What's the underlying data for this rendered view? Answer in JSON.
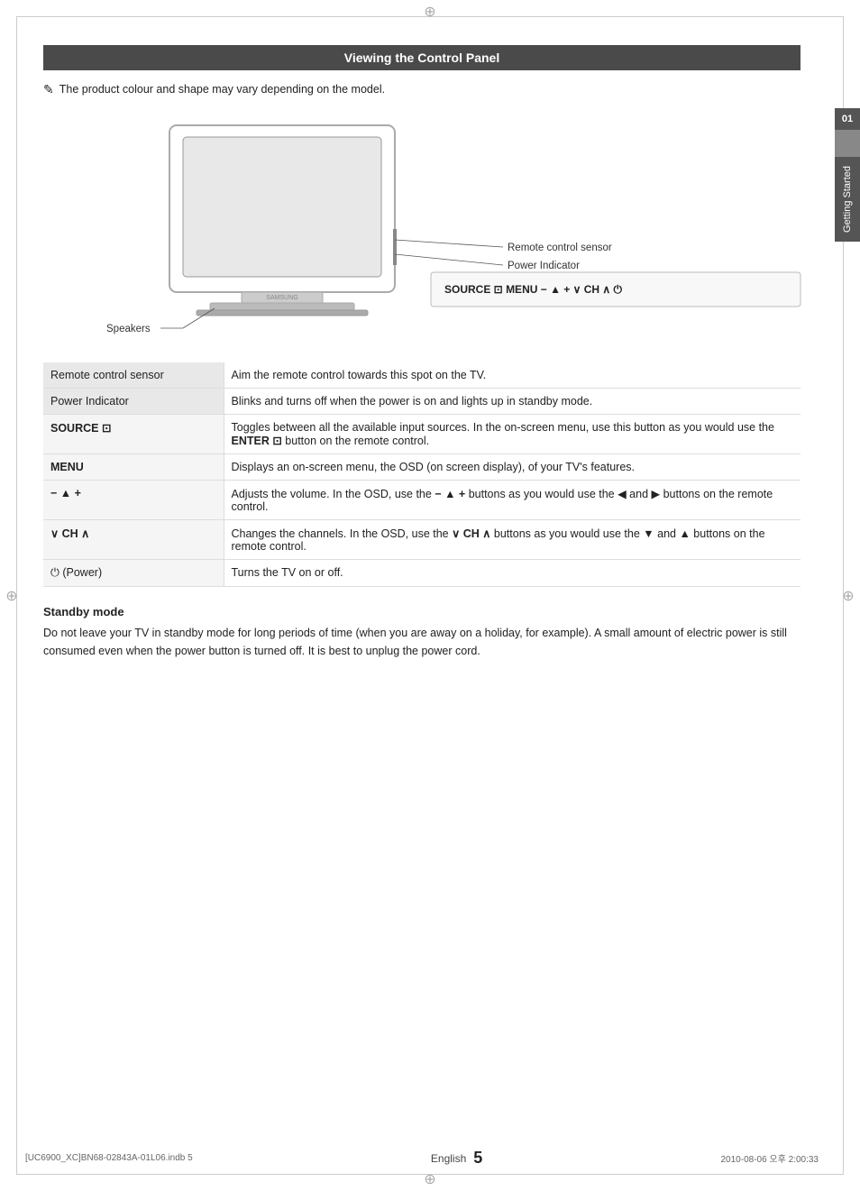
{
  "page": {
    "title": "Viewing the Control Panel",
    "note": "The product colour and shape may vary depending on the model.",
    "note_icon": "✎",
    "tv_labels": {
      "remote_sensor": "Remote control sensor",
      "power_indicator": "Power Indicator",
      "speakers": "Speakers"
    },
    "control_panel_display": "SOURCE  ⊡   MENU  −  ▲ +  ∨ CH ∧  ⏻",
    "table_rows": [
      {
        "label": "Remote control sensor",
        "label_shaded": true,
        "label_bold": false,
        "description": "Aim the remote control towards this spot on the TV."
      },
      {
        "label": "Power Indicator",
        "label_shaded": true,
        "label_bold": false,
        "description": "Blinks and turns off when the power is on and lights up in standby mode."
      },
      {
        "label": "SOURCE ⊡",
        "label_shaded": false,
        "label_bold": true,
        "description": "Toggles between all the available input sources. In the on-screen menu, use this button as you would use the ENTER ⊡ button on the remote control."
      },
      {
        "label": "MENU",
        "label_shaded": false,
        "label_bold": true,
        "description": "Displays an on-screen menu, the OSD (on screen display), of your TV's features."
      },
      {
        "label": "− ▲ +",
        "label_shaded": false,
        "label_bold": true,
        "description": "Adjusts the volume. In the OSD, use the − ▲ + buttons as you would use the ◀ and ▶ buttons on the remote control."
      },
      {
        "label": "∨ CH ∧",
        "label_shaded": false,
        "label_bold": true,
        "description": "Changes the channels. In the OSD, use the ∨ CH ∧ buttons as you would use the ▼ and ▲ buttons on the remote control."
      },
      {
        "label": "⏻ (Power)",
        "label_shaded": false,
        "label_bold": false,
        "description": "Turns the TV on or off."
      }
    ],
    "standby": {
      "title": "Standby mode",
      "text": "Do not leave your TV in standby mode for long periods of time (when you are away on a holiday, for example). A small amount of electric power is still consumed even when the power button is turned off. It is best to unplug the power cord."
    },
    "side_tab": {
      "number": "01",
      "text": "Getting Started"
    },
    "footer": {
      "file_info": "[UC6900_XC]BN68-02843A-01L06.indb   5",
      "date_info": "2010-08-06   오후 2:00:33",
      "language": "English",
      "page_number": "5"
    }
  }
}
